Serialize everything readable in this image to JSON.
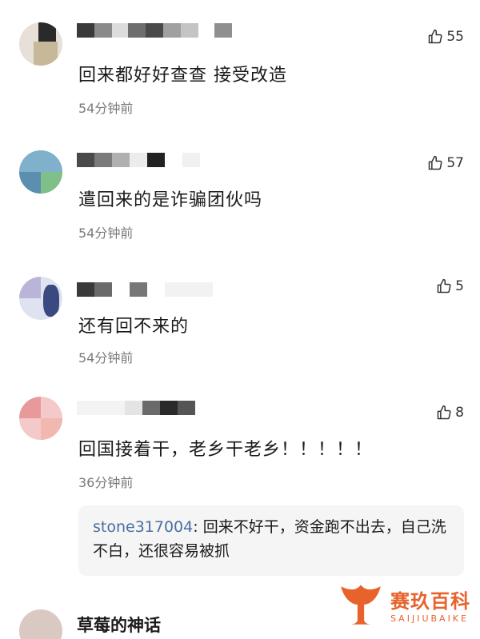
{
  "comments": [
    {
      "text": "回来都好好查查 接受改造",
      "time": "54分钟前",
      "likes": "55"
    },
    {
      "text": "遣回来的是诈骗团伙吗",
      "time": "54分钟前",
      "likes": "57"
    },
    {
      "text": "还有回不来的",
      "time": "54分钟前",
      "likes": "5"
    },
    {
      "text": "回国接着干，老乡干老乡！！！！！",
      "time": "36分钟前",
      "likes": "8"
    }
  ],
  "reply": {
    "user": "stone317004",
    "separator": ": ",
    "text": "回来不好干，资金跑不出去，自己洗不白，还很容易被抓"
  },
  "last_comment": {
    "name": "草莓的神话"
  },
  "watermark": {
    "cn": "赛玖百科",
    "en": "SAIJIUBAIKE"
  },
  "colors": {
    "reply_user": "#4a6fa0",
    "time_gray": "#7a7a7a",
    "reply_bg": "#f5f5f5",
    "brand": "#e8622c"
  }
}
